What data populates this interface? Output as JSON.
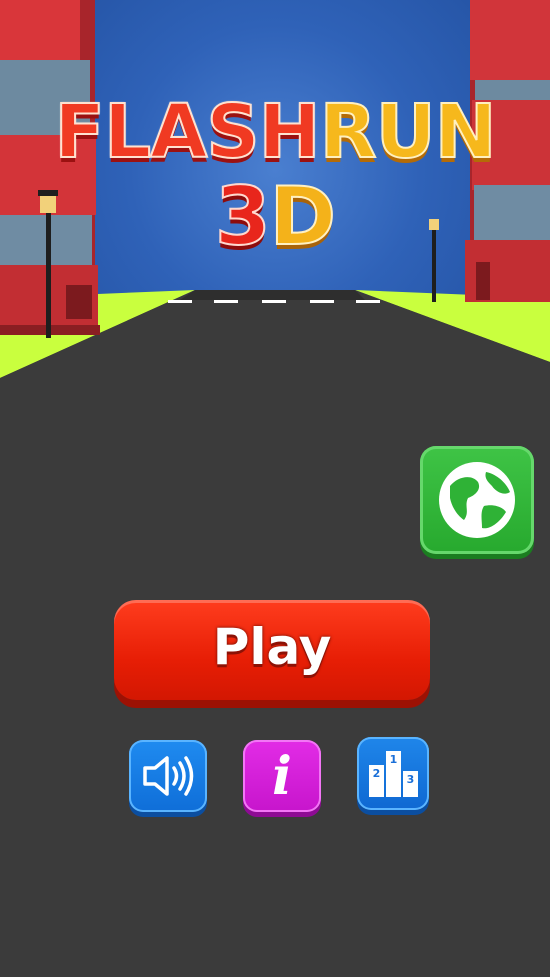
{
  "game": {
    "title_part1": "FLASH",
    "title_part2": "RUN",
    "title_part3": "3",
    "title_part4": "D"
  },
  "menu": {
    "play_label": "Play",
    "info_label": "i",
    "podium_labels": [
      "1",
      "2",
      "3"
    ]
  },
  "icons": {
    "globe": "globe-icon",
    "sound": "speaker-icon",
    "info": "info-icon",
    "leaderboard": "podium-icon"
  },
  "colors": {
    "play": "#e71e05",
    "globe": "#2fb236",
    "sound": "#1a80e6",
    "info": "#d51fd9",
    "leaderboard": "#1a7ae0",
    "road": "#3a3a3a",
    "grass": "#c8ff3c",
    "sky": "#2f62b8"
  }
}
